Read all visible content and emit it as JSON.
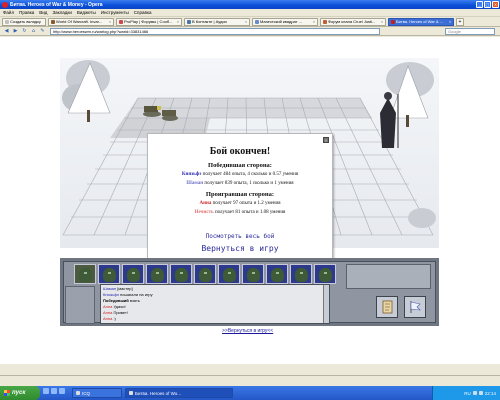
{
  "window": {
    "title": "Битва. Heroes of War & Money - Opera"
  },
  "menu": [
    "Файл",
    "Правка",
    "Вид",
    "Закладки",
    "Виджеты",
    "Инструменты",
    "Справка"
  ],
  "tabs": [
    {
      "label": "Создать вкладку",
      "color": "#c0c0c0",
      "active": false
    },
    {
      "label": "World Of Warcraft. Invar...",
      "color": "#8b5a2b",
      "active": false
    },
    {
      "label": "ProPlay | Форумы | Сооб...",
      "color": "#d04a4a",
      "active": false
    },
    {
      "label": "В Контакте | Аудио",
      "color": "#4a76a8",
      "active": false
    },
    {
      "label": "Магический квадрат ...",
      "color": "#6a8ad0",
      "active": false
    },
    {
      "label": "Форум клана Cruel Justi...",
      "color": "#c06030",
      "active": false
    },
    {
      "label": "Битва. Heroes of War & ...",
      "color": "#c02020",
      "active": true
    }
  ],
  "address": {
    "url": "http://www.heroeswm.ru/warlog.php?warid=33831466",
    "search_placeholder": "Google"
  },
  "dialog": {
    "title": "Бой окончен!",
    "winners_header": "Победившая сторона:",
    "winners": [
      {
        "name": "Князьфэ",
        "name_color": "#2a2ab0",
        "text": "получает 484 опыта, 4 сколько и 0.57 умения"
      },
      {
        "name": "Шаман",
        "name_color": "#6e6ec8",
        "text": "получает 839 опыта, 1 сколько и 1 умения"
      }
    ],
    "losers_header": "Проигравшая сторона:",
    "losers": [
      {
        "name": "Анна",
        "name_color": "#cc2222",
        "text": "получает 97 опыта и 1.2 умения"
      },
      {
        "name": "Нечисть",
        "name_color": "#e07070",
        "text": "получает 81 опыта и 1.08 умения"
      }
    ],
    "view_battle": "Посмотреть весь бой",
    "back_to_game": "Вернуться в игру"
  },
  "chat": [
    {
      "name": "Шаман",
      "color": "#2a2ab0",
      "text": "[мастер]"
    },
    {
      "name": "Князьфэ",
      "color": "#2a2ab0",
      "text": "пошагали на игру"
    },
    {
      "name": "Победивший",
      "color": "#000000",
      "text": "взять"
    },
    {
      "name": "Анна",
      "color": "#cc2222",
      "text": "Удачи!"
    },
    {
      "name": "Анна",
      "color": "#cc2222",
      "text": "Привет!"
    },
    {
      "name": "Анна",
      "color": "#cc2222",
      "text": ":)"
    }
  ],
  "back_link": ">>Вернуться в игру<<",
  "taskbar": {
    "start": "пуск",
    "buttons": [
      {
        "label": "ICQ",
        "active": false
      },
      {
        "label": "Битва. Heroes of Wo...",
        "active": true
      }
    ],
    "tray_lang": "RU",
    "clock": "22:14"
  },
  "units_count": 12
}
